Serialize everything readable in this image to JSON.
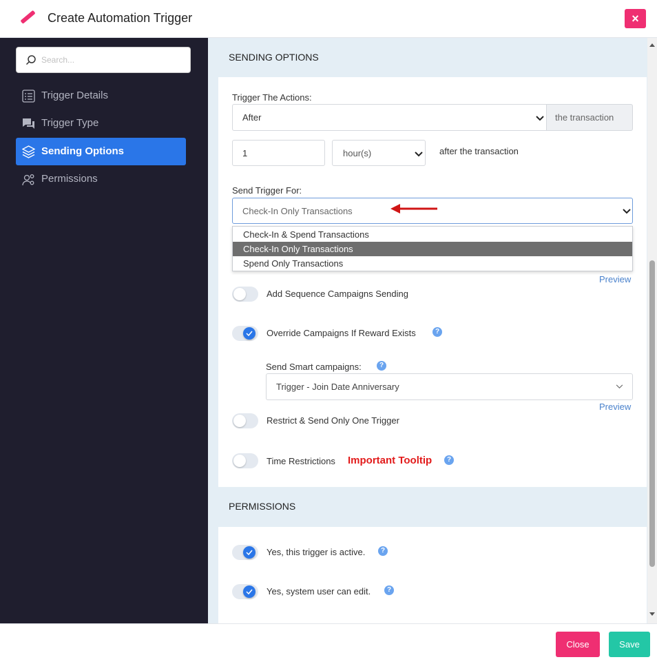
{
  "header": {
    "title": "Create Automation Trigger",
    "close_symbol": "×"
  },
  "sidebar": {
    "search_placeholder": "Search...",
    "items": [
      {
        "label": "Trigger Details",
        "icon": "list-icon"
      },
      {
        "label": "Trigger Type",
        "icon": "chat-icon"
      },
      {
        "label": "Sending Options",
        "icon": "layers-icon",
        "active": true
      },
      {
        "label": "Permissions",
        "icon": "user-gear-icon"
      }
    ]
  },
  "sending_options": {
    "section_title": "SENDING OPTIONS",
    "trigger_actions_label": "Trigger The Actions:",
    "trigger_actions_value": "After",
    "trigger_actions_addon": "the transaction",
    "amount_value": "1",
    "unit_value": "hour(s)",
    "after_text": "after the transaction",
    "send_for_label": "Send Trigger For:",
    "send_for_value": "Check-In Only Transactions",
    "send_for_options": [
      "Check-In & Spend Transactions",
      "Check-In Only Transactions",
      "Spend Only Transactions"
    ],
    "preview_label": "Preview",
    "add_sequence_label": "Add Sequence Campaigns Sending",
    "override_label": "Override Campaigns If Reward Exists",
    "smart_label": "Send Smart campaigns:",
    "smart_value": "Trigger - Join Date Anniversary",
    "preview2_label": "Preview",
    "restrict_label": "Restrict & Send Only One Trigger",
    "time_label": "Time Restrictions",
    "important_label": "Important Tooltip",
    "help_symbol": "?"
  },
  "permissions": {
    "section_title": "PERMISSIONS",
    "active_label": "Yes, this trigger is active.",
    "edit_label": "Yes, system user can edit."
  },
  "footer": {
    "close_label": "Close",
    "save_label": "Save"
  },
  "colors": {
    "primary": "#2a76e8",
    "danger": "#ef2f72",
    "success": "#23c7a6",
    "sidebar": "#1f1e2e",
    "annotation": "#e21b1b"
  }
}
